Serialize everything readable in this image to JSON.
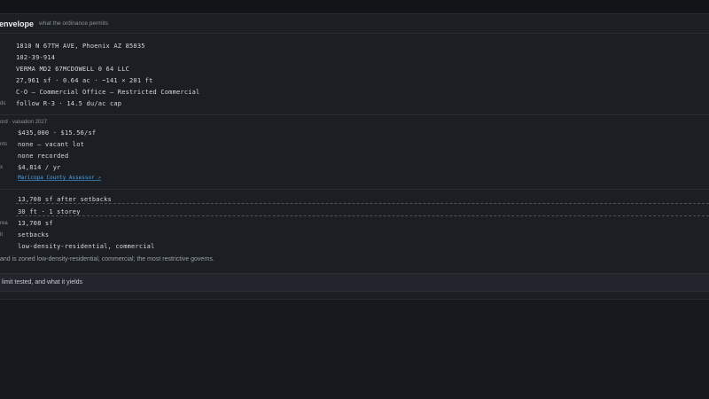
{
  "header": {
    "title": "envelope",
    "subtitle": "what the ordinance permits"
  },
  "section1": {
    "rows": [
      {
        "key": "",
        "value": "1810 N 67TH AVE, Phoenix AZ 85035"
      },
      {
        "key": "",
        "value": "102-39-914"
      },
      {
        "key": "",
        "value": "VERMA MD2 67MCDOWELL 0 64 LLC"
      },
      {
        "key": "",
        "value": "27,961 sf · 0.64 ac · ~141 × 201 ft"
      },
      {
        "key": "",
        "value": "C-O — Commercial Office — Restricted Commercial"
      },
      {
        "key": "ds",
        "value": "follow R-3 · 14.5 du/ac cap"
      }
    ]
  },
  "section2": {
    "label": "ord · valuation 2027",
    "rows": [
      {
        "key": "",
        "value": "$435,000 · $15.56/sf"
      },
      {
        "key": "nts",
        "value": "none — vacant lot"
      },
      {
        "key": "",
        "value": "none recorded"
      },
      {
        "key": "x",
        "value": "$4,814 / yr"
      }
    ],
    "link": "Maricopa County Assessor ↗"
  },
  "section3": {
    "rows": [
      {
        "key": "",
        "value": "13,708 sf after setbacks"
      },
      {
        "key": "",
        "value": "30 ft · 1 storey"
      },
      {
        "key": "rea",
        "value": "13,708 sf"
      },
      {
        "key": "it",
        "value": "setbacks"
      },
      {
        "key": "",
        "value": "low-density-residential, commercial"
      }
    ]
  },
  "note": "and is zoned low-density-residential, commercial; the most restrictive governs.",
  "footer": {
    "label": "limit tested, and what it yields"
  }
}
